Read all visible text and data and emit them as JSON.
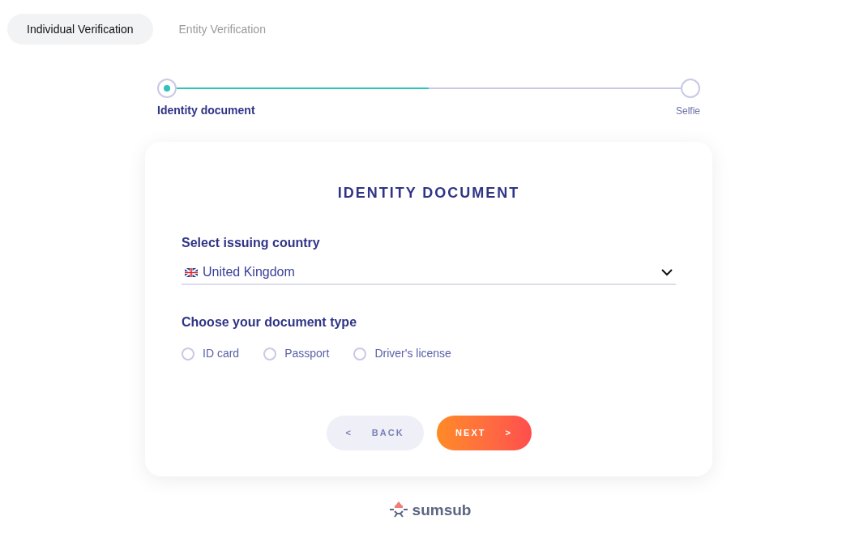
{
  "tabs": [
    {
      "label": "Individual Verification",
      "selected": true
    },
    {
      "label": "Entity Verification",
      "selected": false
    }
  ],
  "steps": {
    "level": 0.5,
    "items": [
      {
        "label": "Identity document",
        "selected": true
      },
      {
        "label": "Selfie",
        "selected": false
      }
    ]
  },
  "card": {
    "title": "IDENTITY DOCUMENT",
    "country_label": "Select issuing country",
    "country": {
      "value": "United Kingdom"
    },
    "document_type_label": "Choose your document type",
    "document_types": [
      {
        "label": "ID card",
        "selected": false
      },
      {
        "label": "Passport",
        "selected": false
      },
      {
        "label": "Driver's license",
        "selected": false
      }
    ],
    "back": {
      "arrow": "<",
      "label": "BACK"
    },
    "next": {
      "label": "NEXT",
      "arrow": ">"
    }
  },
  "footer": {
    "logo_text": "sumsub"
  }
}
